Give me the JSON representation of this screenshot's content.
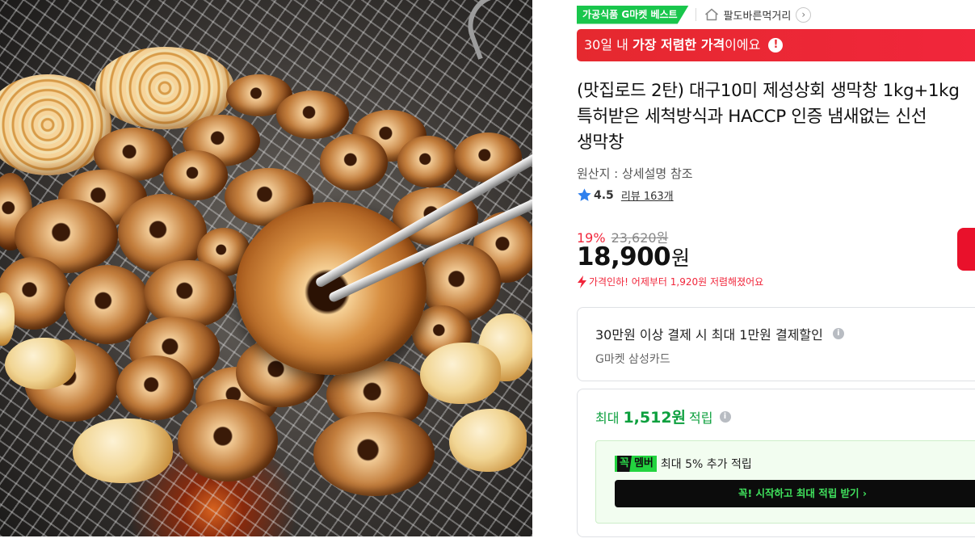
{
  "product_image": {
    "alt_icon": "grilled-makchang-photo"
  },
  "badges": {
    "best": "가공식품 G마켓 베스트",
    "store_name": "팔도바른먹거리",
    "store_arrow": "›"
  },
  "lowest_price_banner": {
    "prefix": "30일 내 ",
    "highlight": "가장 저렴한 가격",
    "suffix": "이에요",
    "info_icon": "!"
  },
  "title": {
    "line1": "(맛집로드 2탄) 대구10미 제성상회 생막창 1kg+1kg",
    "line2": "특허받은 세척방식과 HACCP 인증 냄새없는 신선",
    "line3": "생막창"
  },
  "origin": "원산지 : 상세설명 참조",
  "rating": {
    "score": "4.5",
    "reviews": "리뷰 163개"
  },
  "pricing": {
    "discount_rate": "19%",
    "original_price": "23,620원",
    "sale_price": "18,900",
    "currency": "원",
    "price_drop_note": "가격인하! 어제부터 1,920원 저렴해졌어요"
  },
  "card_discount": {
    "title": "30만원 이상 결제 시 최대 1만원 결제할인",
    "info_icon": "i",
    "card_name": "G마켓 삼성카드"
  },
  "points": {
    "prefix": "최대",
    "amount": "1,512원",
    "suffix": "적립",
    "info_icon": "i",
    "member_tag": "꼭",
    "member_label": "멤버",
    "member_text": "최대 5% 추가 적립",
    "join_button": "꼭! 시작하고 최대 적립 받기  ›"
  },
  "colors": {
    "accent_red": "#f1263b",
    "best_green": "#19c64c",
    "point_green": "#0da03e",
    "member_green": "#23d43f"
  }
}
